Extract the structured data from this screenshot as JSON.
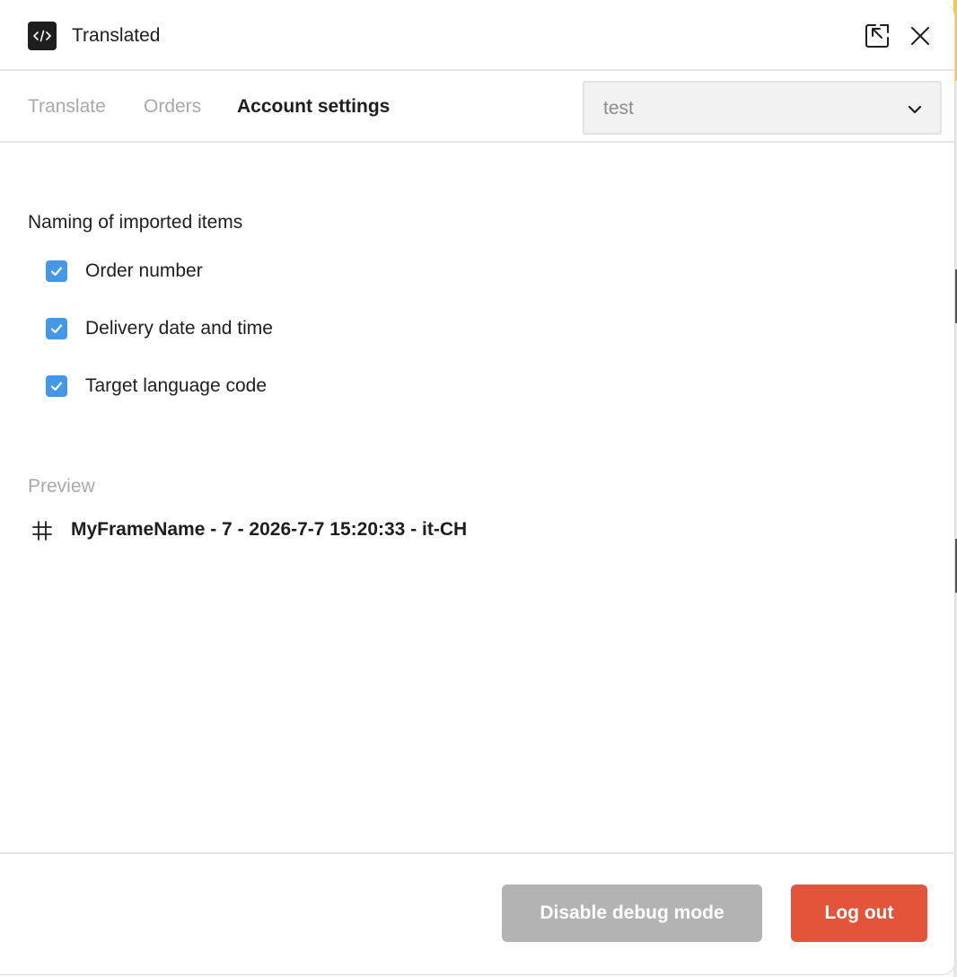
{
  "header": {
    "title": "Translated",
    "logo_icon": "code-icon",
    "expand_icon": "expand-arrow-icon",
    "close_icon": "close-icon"
  },
  "tabs": [
    {
      "label": "Translate",
      "active": false
    },
    {
      "label": "Orders",
      "active": false
    },
    {
      "label": "Account settings",
      "active": true
    }
  ],
  "account_select": {
    "value": "test"
  },
  "naming": {
    "title": "Naming of imported items",
    "options": [
      {
        "label": "Order number",
        "checked": true
      },
      {
        "label": "Delivery date and time",
        "checked": true
      },
      {
        "label": "Target language code",
        "checked": true
      }
    ]
  },
  "preview": {
    "label": "Preview",
    "icon": "frame-hash-icon",
    "value": "MyFrameName - 7 - 2026-7-7 15:20:33 - it-CH"
  },
  "footer": {
    "debug_label": "Disable debug mode",
    "logout_label": "Log out"
  },
  "colors": {
    "accent_blue": "#4598e8",
    "logout_red": "#e4543a",
    "debug_gray": "#b3b3b3"
  }
}
